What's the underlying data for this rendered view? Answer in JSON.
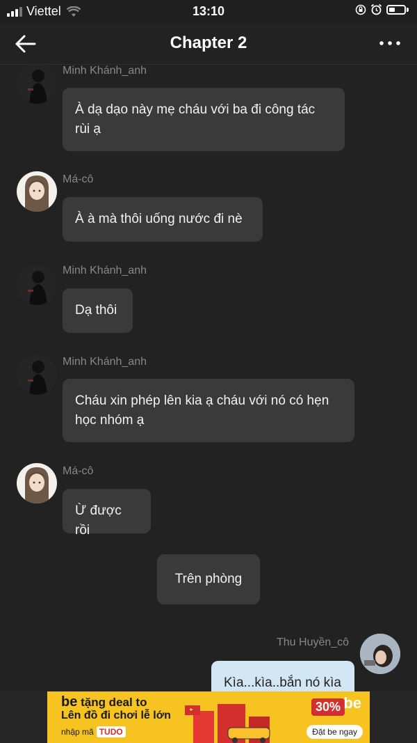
{
  "status_bar": {
    "carrier": "Viettel",
    "time": "13:10"
  },
  "header": {
    "title": "Chapter 2"
  },
  "messages": [
    {
      "sender": "Minh Khánh_anh",
      "text": "À dạ dạo này mẹ cháu với ba đi công tác\nrùi ạ"
    },
    {
      "sender": "Má-cô",
      "text": "À à mà thôi uống nước đi nè"
    },
    {
      "sender": "Minh Khánh_anh",
      "text": "Dạ thôi"
    },
    {
      "sender": "Minh Khánh_anh",
      "text": "Cháu xin phép lên kia ạ cháu với nó có hẹn\nhọc nhóm ạ"
    },
    {
      "sender": "Má-cô",
      "text": "Ừ được rồi"
    },
    {
      "text": "Trên phòng"
    },
    {
      "sender": "Thu Huyền_cô",
      "text": "Kìa...kìa..bắn nó kìa"
    }
  ],
  "ad": {
    "brand": "be",
    "line1": "tặng deal to",
    "line2": "Lên đồ đi chơi lễ lớn",
    "code_label": "nhập mã",
    "code": "TUDO",
    "discount": "30%",
    "cta": "Đặt be ngay"
  },
  "colors": {
    "background": "#222222",
    "bubble": "#3a3a3a",
    "own_bubble": "#d2e6f3",
    "ad_yellow": "#f6c321"
  }
}
